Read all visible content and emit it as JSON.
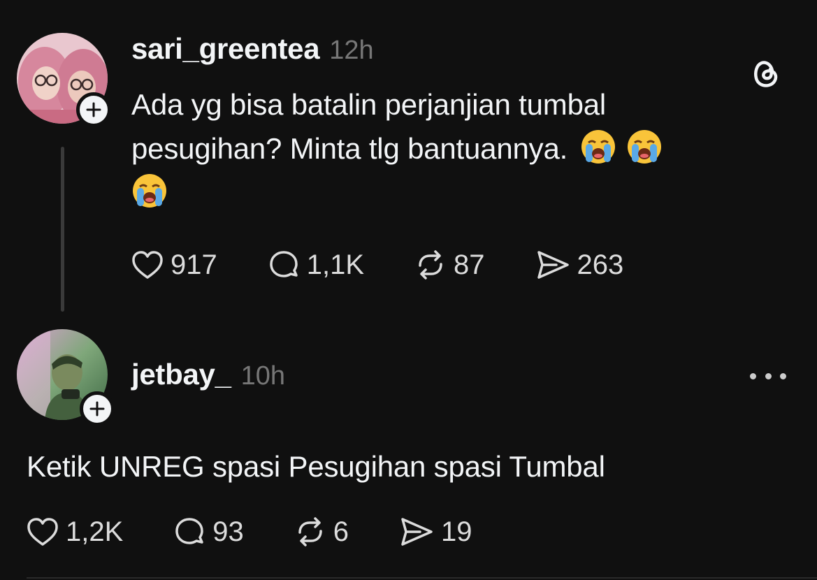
{
  "post": {
    "username": "sari_greentea",
    "timestamp": "12h",
    "text_line1": "Ada yg bisa batalin perjanjian tumbal",
    "text_line2": "pesugihan? Minta tlg bantuannya.",
    "emoji": "loudly-crying-face",
    "likes": "917",
    "replies": "1,1K",
    "reposts": "87",
    "shares": "263"
  },
  "reply": {
    "username": "jetbay_",
    "timestamp": "10h",
    "text": "Ketik UNREG spasi Pesugihan spasi Tumbal",
    "likes": "1,2K",
    "replies": "93",
    "reposts": "6",
    "shares": "19"
  },
  "colors": {
    "background": "#101010",
    "text": "#f3f5f7",
    "muted": "#777777"
  }
}
